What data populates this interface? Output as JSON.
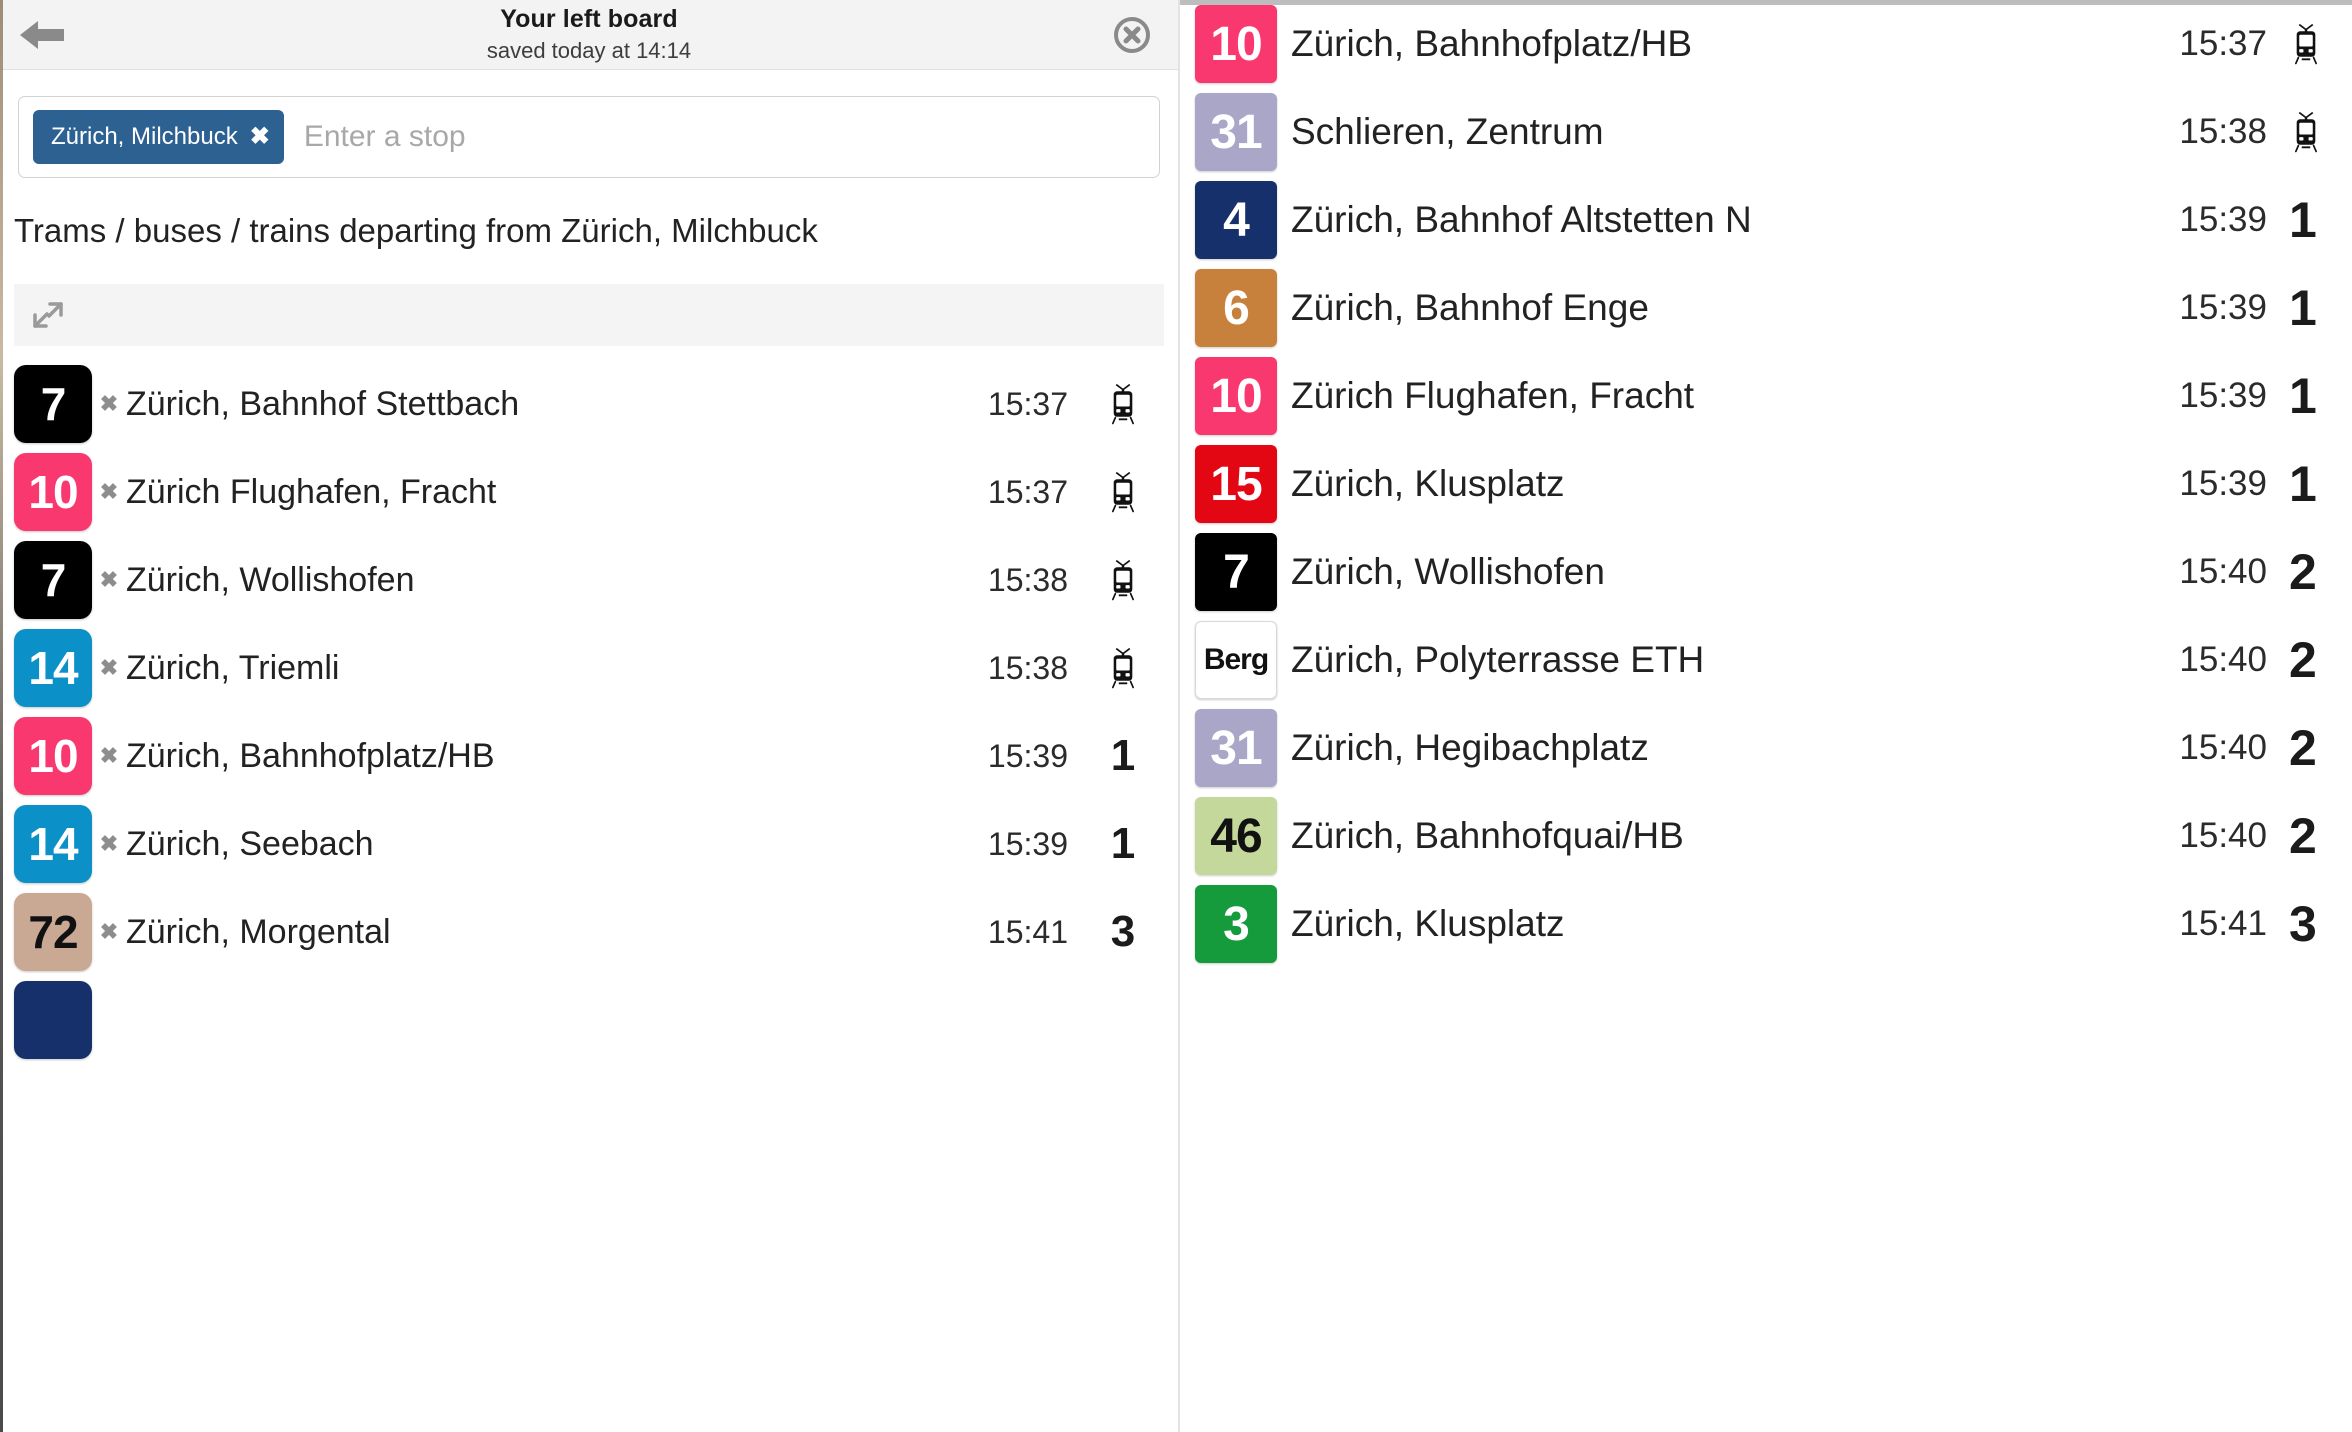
{
  "header": {
    "title": "Your left board",
    "subtitle": "saved today at 14:14",
    "back_icon": "back-arrow-icon",
    "close_icon": "close-circle-icon"
  },
  "search": {
    "chip_label": "Zürich, Milchbuck",
    "chip_remove": "✖",
    "placeholder": "Enter a stop",
    "value": ""
  },
  "description": "Trams / buses / trains departing from Zürich, Milchbuck",
  "expander": {
    "icon": "expand-diagonal-icon"
  },
  "colors": {
    "line_7": "#000000",
    "line_10": "#F8386E",
    "line_14": "#0B90C8",
    "line_72": "#C9A994",
    "line_31": "#A9A6C8",
    "line_4": "#16306B",
    "line_6": "#C8813C",
    "line_15": "#E30613",
    "line_berg": "#FFFFFF",
    "line_46": "#C3D89A",
    "line_3": "#159A3C",
    "chip_bg": "#2C6191",
    "header_bg": "#F3F3F3",
    "expander_bg": "#F4F4F4"
  },
  "left_board": {
    "departures": [
      {
        "line": "7",
        "bg": "#000000",
        "fg": "#FFFFFF",
        "x": "✖",
        "destination": "Zürich, Bahnhof Stettbach",
        "time": "15:37",
        "platform": "",
        "icon": "tram-icon"
      },
      {
        "line": "10",
        "bg": "#F8386E",
        "fg": "#FFFFFF",
        "x": "✖",
        "destination": "Zürich Flughafen, Fracht",
        "time": "15:37",
        "platform": "",
        "icon": "tram-icon"
      },
      {
        "line": "7",
        "bg": "#000000",
        "fg": "#FFFFFF",
        "x": "✖",
        "destination": "Zürich, Wollishofen",
        "time": "15:38",
        "platform": "",
        "icon": "tram-icon"
      },
      {
        "line": "14",
        "bg": "#0B90C8",
        "fg": "#FFFFFF",
        "x": "✖",
        "destination": "Zürich, Triemli",
        "time": "15:38",
        "platform": "",
        "icon": "tram-icon"
      },
      {
        "line": "10",
        "bg": "#F8386E",
        "fg": "#FFFFFF",
        "x": "✖",
        "destination": "Zürich, Bahnhofplatz/HB",
        "time": "15:39",
        "platform": "1",
        "icon": ""
      },
      {
        "line": "14",
        "bg": "#0B90C8",
        "fg": "#FFFFFF",
        "x": "✖",
        "destination": "Zürich, Seebach",
        "time": "15:39",
        "platform": "1",
        "icon": ""
      },
      {
        "line": "72",
        "bg": "#C9A994",
        "fg": "#111111",
        "x": "✖",
        "destination": "Zürich, Morgental",
        "time": "15:41",
        "platform": "3",
        "icon": ""
      },
      {
        "line": "",
        "bg": "#16306B",
        "fg": "#FFFFFF",
        "x": "",
        "destination": "",
        "time": "",
        "platform": "",
        "icon": ""
      }
    ]
  },
  "right_board": {
    "departures": [
      {
        "line": "10",
        "bg": "#F8386E",
        "fg": "#FFFFFF",
        "destination": "Zürich, Bahnhofplatz/HB",
        "time": "15:37",
        "platform": "",
        "icon": "tram-icon"
      },
      {
        "line": "31",
        "bg": "#A9A6C8",
        "fg": "#FFFFFF",
        "destination": "Schlieren, Zentrum",
        "time": "15:38",
        "platform": "",
        "icon": "tram-icon"
      },
      {
        "line": "4",
        "bg": "#16306B",
        "fg": "#FFFFFF",
        "destination": "Zürich, Bahnhof Altstetten N",
        "time": "15:39",
        "platform": "1",
        "icon": ""
      },
      {
        "line": "6",
        "bg": "#C8813C",
        "fg": "#FFFFFF",
        "destination": "Zürich, Bahnhof Enge",
        "time": "15:39",
        "platform": "1",
        "icon": ""
      },
      {
        "line": "10",
        "bg": "#F8386E",
        "fg": "#FFFFFF",
        "destination": "Zürich Flughafen, Fracht",
        "time": "15:39",
        "platform": "1",
        "icon": ""
      },
      {
        "line": "15",
        "bg": "#E30613",
        "fg": "#FFFFFF",
        "destination": "Zürich, Klusplatz",
        "time": "15:39",
        "platform": "1",
        "icon": ""
      },
      {
        "line": "7",
        "bg": "#000000",
        "fg": "#FFFFFF",
        "destination": "Zürich, Wollishofen",
        "time": "15:40",
        "platform": "2",
        "icon": ""
      },
      {
        "line": "Berg",
        "bg": "#FFFFFF",
        "fg": "#111111",
        "destination": "Zürich, Polyterrasse ETH",
        "time": "15:40",
        "platform": "2",
        "icon": ""
      },
      {
        "line": "31",
        "bg": "#A9A6C8",
        "fg": "#FFFFFF",
        "destination": "Zürich, Hegibachplatz",
        "time": "15:40",
        "platform": "2",
        "icon": ""
      },
      {
        "line": "46",
        "bg": "#C3D89A",
        "fg": "#111111",
        "destination": "Zürich, Bahnhofquai/HB",
        "time": "15:40",
        "platform": "2",
        "icon": ""
      },
      {
        "line": "3",
        "bg": "#159A3C",
        "fg": "#FFFFFF",
        "destination": "Zürich, Klusplatz",
        "time": "15:41",
        "platform": "3",
        "icon": ""
      }
    ]
  }
}
